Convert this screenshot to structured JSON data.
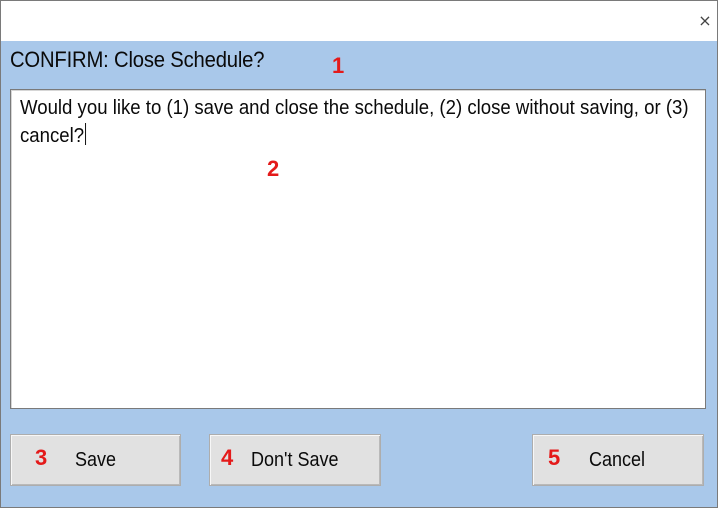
{
  "window": {
    "close_glyph": "×"
  },
  "dialog": {
    "heading": "CONFIRM: Close Schedule?",
    "message": "Would you like to (1) save and close the schedule, (2) close without saving, or (3) cancel?"
  },
  "buttons": {
    "save_label": "Save",
    "dont_save_label": "Don't Save",
    "cancel_label": "Cancel"
  },
  "annotations": {
    "heading_marker": "1",
    "message_marker": "2",
    "save_marker": "3",
    "dont_save_marker": "4",
    "cancel_marker": "5"
  },
  "colors": {
    "dialog_background": "#a9c8ea",
    "annotation_red": "#e41a1a",
    "button_face": "#e1e1e1"
  }
}
